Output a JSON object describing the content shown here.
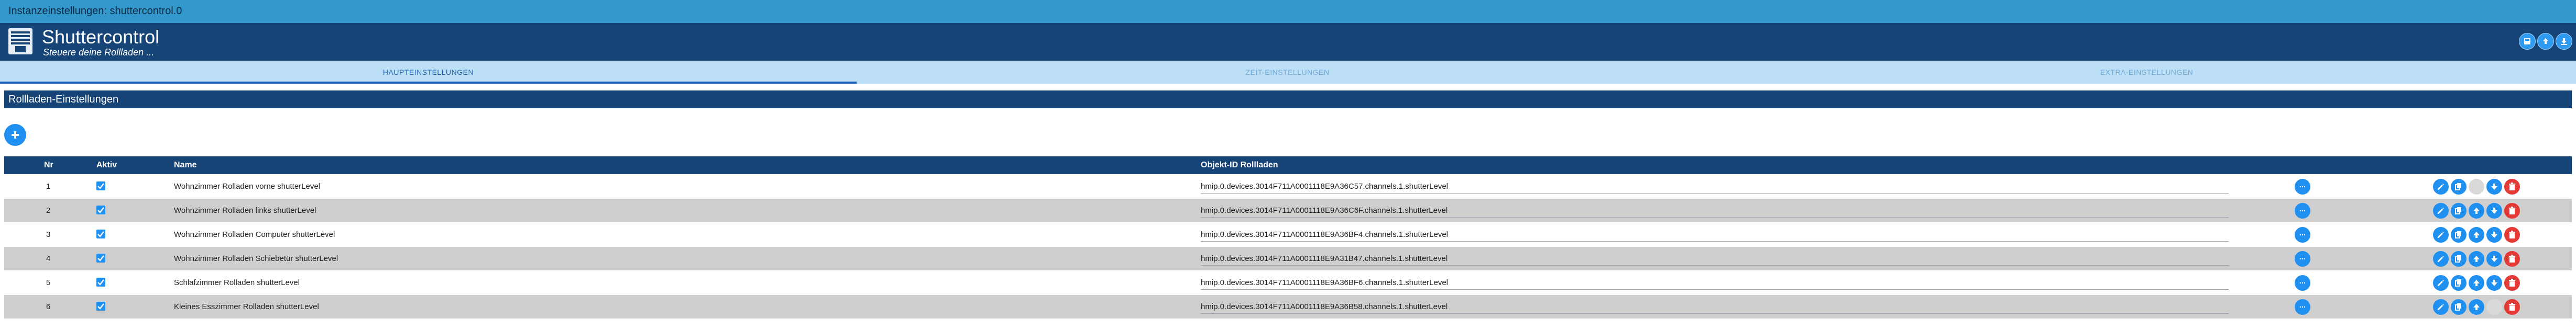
{
  "window": {
    "title": "Instanzeinstellungen: shuttercontrol.0"
  },
  "header": {
    "app_title": "Shuttercontrol",
    "app_subtitle": "Steuere deine Rollladen ...",
    "buttons": [
      "save-to-file-icon",
      "load-from-file-icon",
      "export-icon"
    ]
  },
  "tabs": [
    {
      "label": "HAUPTEINSTELLUNGEN",
      "active": true
    },
    {
      "label": "ZEIT-EINSTELLUNGEN",
      "active": false
    },
    {
      "label": "EXTRA-EINSTELLUNGEN",
      "active": false
    }
  ],
  "section": {
    "title": "Rollladen-Einstellungen"
  },
  "table": {
    "columns": {
      "nr": "Nr",
      "active": "Aktiv",
      "name": "Name",
      "object_id": "Objekt-ID Rollladen"
    },
    "rows": [
      {
        "nr": "1",
        "active": true,
        "name": "Wohnzimmer Rolladen vorne shutterLevel",
        "object_id": "hmip.0.devices.3014F711A0001118E9A36C57.channels.1.shutterLevel",
        "actions": [
          "edit-icon",
          "copy-icon",
          "move-up-icon-disabled",
          "move-down-icon",
          "delete-icon"
        ]
      },
      {
        "nr": "2",
        "active": true,
        "name": "Wohnzimmer Rolladen links shutterLevel",
        "object_id": "hmip.0.devices.3014F711A0001118E9A36C6F.channels.1.shutterLevel",
        "actions": [
          "edit-icon",
          "copy-icon",
          "move-up-icon",
          "move-down-icon",
          "delete-icon"
        ]
      },
      {
        "nr": "3",
        "active": true,
        "name": "Wohnzimmer Rolladen Computer shutterLevel",
        "object_id": "hmip.0.devices.3014F711A0001118E9A36BF4.channels.1.shutterLevel",
        "actions": [
          "edit-icon",
          "copy-icon",
          "move-up-icon",
          "move-down-icon",
          "delete-icon"
        ]
      },
      {
        "nr": "4",
        "active": true,
        "name": "Wohnzimmer Rolladen Schiebetür shutterLevel",
        "object_id": "hmip.0.devices.3014F711A0001118E9A31B47.channels.1.shutterLevel",
        "actions": [
          "edit-icon",
          "copy-icon",
          "move-up-icon",
          "move-down-icon",
          "delete-icon"
        ]
      },
      {
        "nr": "5",
        "active": true,
        "name": "Schlafzimmer Rolladen shutterLevel",
        "object_id": "hmip.0.devices.3014F711A0001118E9A36BF6.channels.1.shutterLevel",
        "actions": [
          "edit-icon",
          "copy-icon",
          "move-up-icon",
          "move-down-icon",
          "delete-icon"
        ]
      },
      {
        "nr": "6",
        "active": true,
        "name": "Kleines Esszimmer Rolladen shutterLevel",
        "object_id": "hmip.0.devices.3014F711A0001118E9A36B58.channels.1.shutterLevel",
        "actions": [
          "edit-icon",
          "copy-icon",
          "move-up-icon",
          "move-down-icon-disabled",
          "delete-icon"
        ]
      }
    ]
  },
  "colors": {
    "primary": "#164477",
    "accent": "#1f8ff0",
    "titlebar": "#3399cc",
    "delete": "#e53935",
    "alt_row": "#cfcfcf"
  }
}
